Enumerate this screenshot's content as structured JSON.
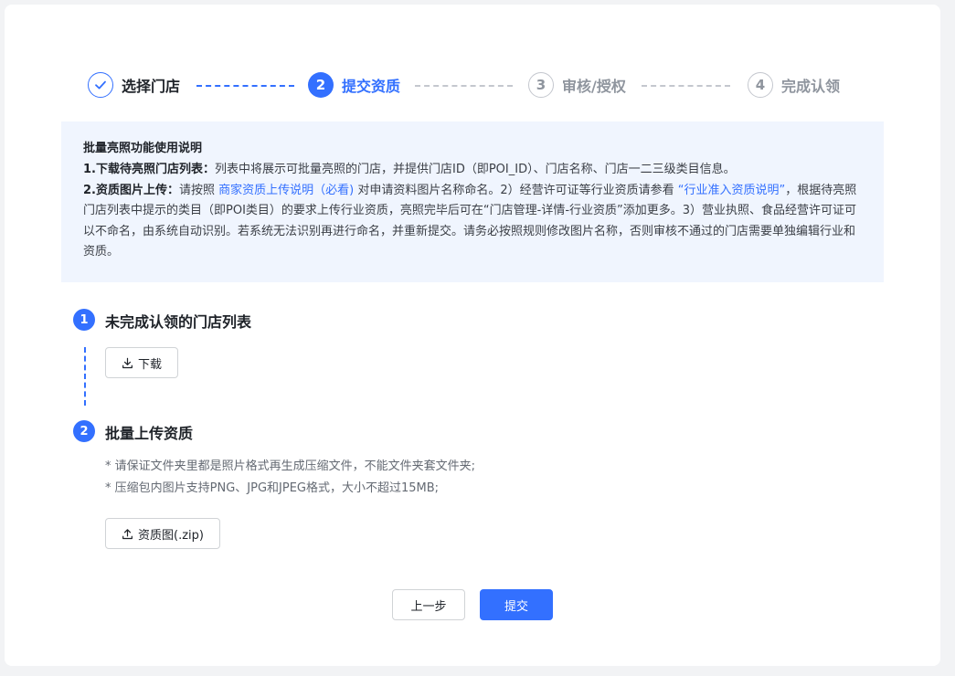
{
  "steps": [
    {
      "num": "",
      "label": "选择门店",
      "state": "done"
    },
    {
      "num": "2",
      "label": "提交资质",
      "state": "active"
    },
    {
      "num": "3",
      "label": "审核/授权",
      "state": "pending"
    },
    {
      "num": "4",
      "label": "完成认领",
      "state": "pending"
    }
  ],
  "info": {
    "title": "批量亮照功能使用说明",
    "line1_bold": "1.下载待亮照门店列表：",
    "line1_text": "列表中将展示可批量亮照的门店，并提供门店ID（即POI_ID）、门店名称、门店一二三级类目信息。",
    "line2_bold": "2.资质图片上传：",
    "line2_pre": "请按照 ",
    "line2_link1": "商家资质上传说明（必看)",
    "line2_mid": " 对申请资料图片名称命名。2）经营许可证等行业资质请参看 ",
    "line2_link2": "“行业准入资质说明”",
    "line2_rest": "，根据待亮照门店列表中提示的类目（即POI类目）的要求上传行业资质，亮照完毕后可在“门店管理-详情-行业资质”添加更多。3）营业执照、食品经营许可证可以不命名，由系统自动识别。若系统无法识别再进行命名，并重新提交。请务必按照规则修改图片名称，否则审核不通过的门店需要单独编辑行业和资质。"
  },
  "section1": {
    "num": "1",
    "title": "未完成认领的门店列表",
    "download_label": "下载",
    "download_icon": "download-icon"
  },
  "section2": {
    "num": "2",
    "title": "批量上传资质",
    "notes": [
      "* 请保证文件夹里都是照片格式再生成压缩文件，不能文件夹套文件夹;",
      "* 压缩包内图片支持PNG、JPG和JPEG格式，大小不超过15MB;"
    ],
    "upload_label": "资质图(.zip)",
    "upload_icon": "upload-icon"
  },
  "footer": {
    "prev_label": "上一步",
    "submit_label": "提交"
  },
  "colors": {
    "primary": "#3370ff",
    "info_bg": "#f0f5fe",
    "pending": "#8f959e"
  }
}
